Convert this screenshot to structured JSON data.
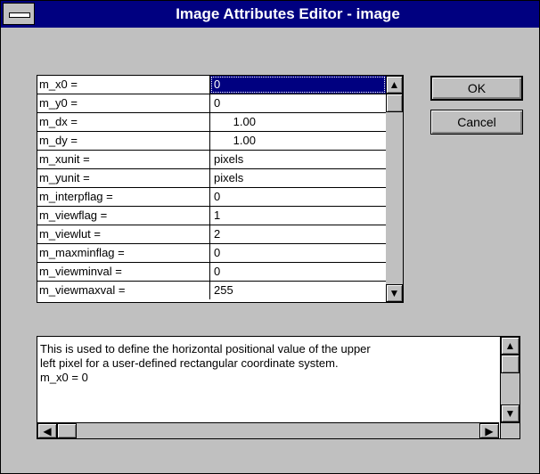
{
  "window": {
    "title": "Image Attributes Editor - image"
  },
  "attributes": [
    {
      "name": "m_x0 =",
      "value": "0",
      "selected": true
    },
    {
      "name": "m_y0 =",
      "value": "0"
    },
    {
      "name": "m_dx =",
      "value": "      1.00"
    },
    {
      "name": "m_dy =",
      "value": "      1.00"
    },
    {
      "name": "m_xunit =",
      "value": "pixels"
    },
    {
      "name": "m_yunit =",
      "value": "pixels"
    },
    {
      "name": "m_interpflag =",
      "value": "0"
    },
    {
      "name": "m_viewflag =",
      "value": "1"
    },
    {
      "name": "m_viewlut =",
      "value": "2"
    },
    {
      "name": "m_maxminflag =",
      "value": "0"
    },
    {
      "name": "m_viewminval =",
      "value": "0"
    },
    {
      "name": "m_viewmaxval =",
      "value": "255"
    }
  ],
  "buttons": {
    "ok": "OK",
    "cancel": "Cancel"
  },
  "description": {
    "line1": "This is used to define the horizontal positional value of the upper",
    "line2": "left pixel for a user-defined rectangular coordinate system.",
    "line3": "m_x0 = 0"
  },
  "icons": {
    "up": "▲",
    "down": "▼",
    "left": "◀",
    "right": "▶"
  }
}
